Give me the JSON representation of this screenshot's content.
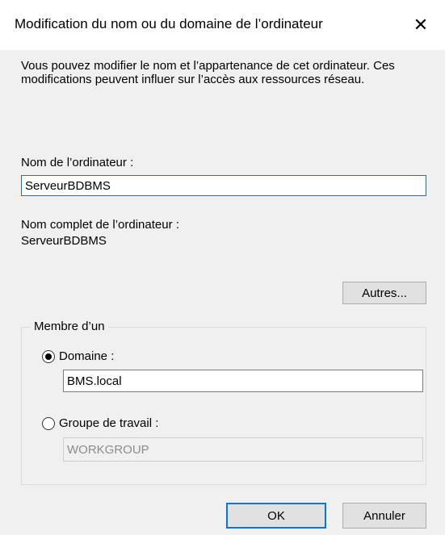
{
  "window": {
    "title": "Modification du nom ou du domaine de l’ordinateur",
    "close_glyph": "✕"
  },
  "description": "Vous pouvez modifier le nom et l’appartenance de cet ordinateur. Ces modifications peuvent influer sur l’accès aux ressources réseau.",
  "computer_name": {
    "label": "Nom de l’ordinateur :",
    "value": "ServeurBDBMS"
  },
  "full_name": {
    "label": "Nom complet de l’ordinateur :",
    "value": "ServeurBDBMS"
  },
  "more_button": "Autres...",
  "membership": {
    "legend": "Membre d’un",
    "domain": {
      "label": "Domaine :",
      "value": "BMS.local",
      "selected": true
    },
    "workgroup": {
      "label": "Groupe de travail :",
      "value": "WORKGROUP",
      "selected": false
    }
  },
  "buttons": {
    "ok": "OK",
    "cancel": "Annuler"
  },
  "colors": {
    "focus_accent": "#0078d7",
    "dialog_bg": "#f0f0f0"
  }
}
